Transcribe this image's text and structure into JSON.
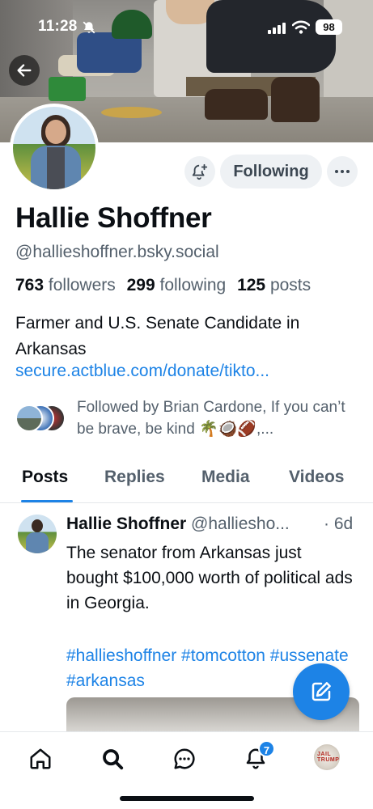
{
  "status_bar": {
    "time": "11:28",
    "battery": "98"
  },
  "profile": {
    "display_name": "Hallie Shoffner",
    "handle": "@hallieshoffner.bsky.social",
    "followers_count": "763",
    "followers_label": "followers",
    "following_count": "299",
    "following_label": "following",
    "posts_count": "125",
    "posts_label": "posts",
    "bio": "Farmer and U.S. Senate Candidate in Arkansas",
    "link": "secure.actblue.com/donate/tikto...",
    "followed_by": "Followed by Brian Cardone, If you can’t be brave, be kind 🌴🥥🏈,..."
  },
  "actions": {
    "follow_label": "Following"
  },
  "tabs": [
    "Posts",
    "Replies",
    "Media",
    "Videos"
  ],
  "post": {
    "author": "Hallie Shoffner",
    "handle": "@halliesho...",
    "time": "· 6d",
    "text": "The senator from Arkansas just bought $100,000 worth of political ads in Georgia.",
    "tags": "#hallieshoffner #tomcotton #ussenate #arkansas"
  },
  "nav": {
    "notifications_badge": "7",
    "avatar_text": "JAIL TRUMP"
  },
  "icons": [
    "back-arrow-icon",
    "bell-off-icon",
    "signal-icon",
    "wifi-icon",
    "bell-plus-icon",
    "more-icon",
    "compose-icon",
    "home-icon",
    "search-icon",
    "chat-icon",
    "bell-icon"
  ],
  "colors": {
    "accent": "#1d83e6",
    "text": "#0b0f14",
    "muted": "#54606c",
    "button_bg": "#eef1f4"
  }
}
